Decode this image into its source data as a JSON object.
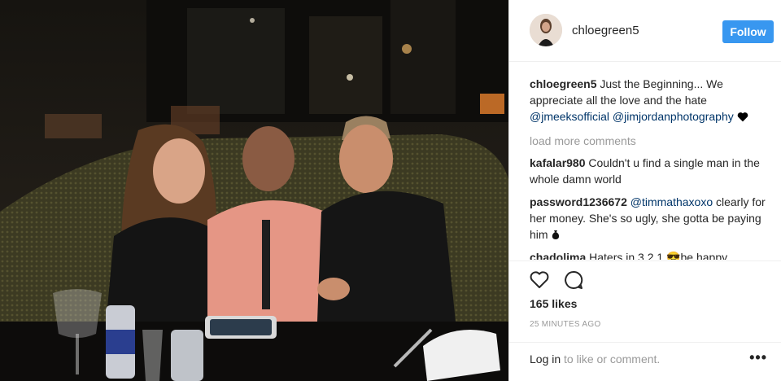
{
  "post": {
    "username": "chloegreen5",
    "follow_label": "Follow",
    "caption": {
      "user": "chloegreen5",
      "text": "Just the Beginning... We appreciate all the love and the hate",
      "mention1": "@jmeeksofficial",
      "mention2": "@jimjordanphotography"
    },
    "load_more": "load more comments",
    "comments": [
      {
        "user": "kafalar980",
        "text": "Couldn't u find a single man in the whole damn world",
        "mention": ""
      },
      {
        "user": "password1236672",
        "text": "clearly for her money. She's so ugly, she gotta be paying him",
        "mention": "@timmathaxoxo"
      },
      {
        "user": "chadolima",
        "text": "Haters in 3 2 1 😎be happy",
        "mention": ""
      }
    ],
    "likes": "165 likes",
    "time": "25 MINUTES AGO",
    "login_link": "Log in",
    "login_text": " to like or comment.",
    "more_label": "•••"
  },
  "icons": {
    "like": "heart-icon",
    "comment": "comment-icon",
    "options": "more-options-icon"
  },
  "colors": {
    "accent": "#3897f0",
    "mention": "#003569",
    "muted": "#999999",
    "text": "#262626"
  }
}
